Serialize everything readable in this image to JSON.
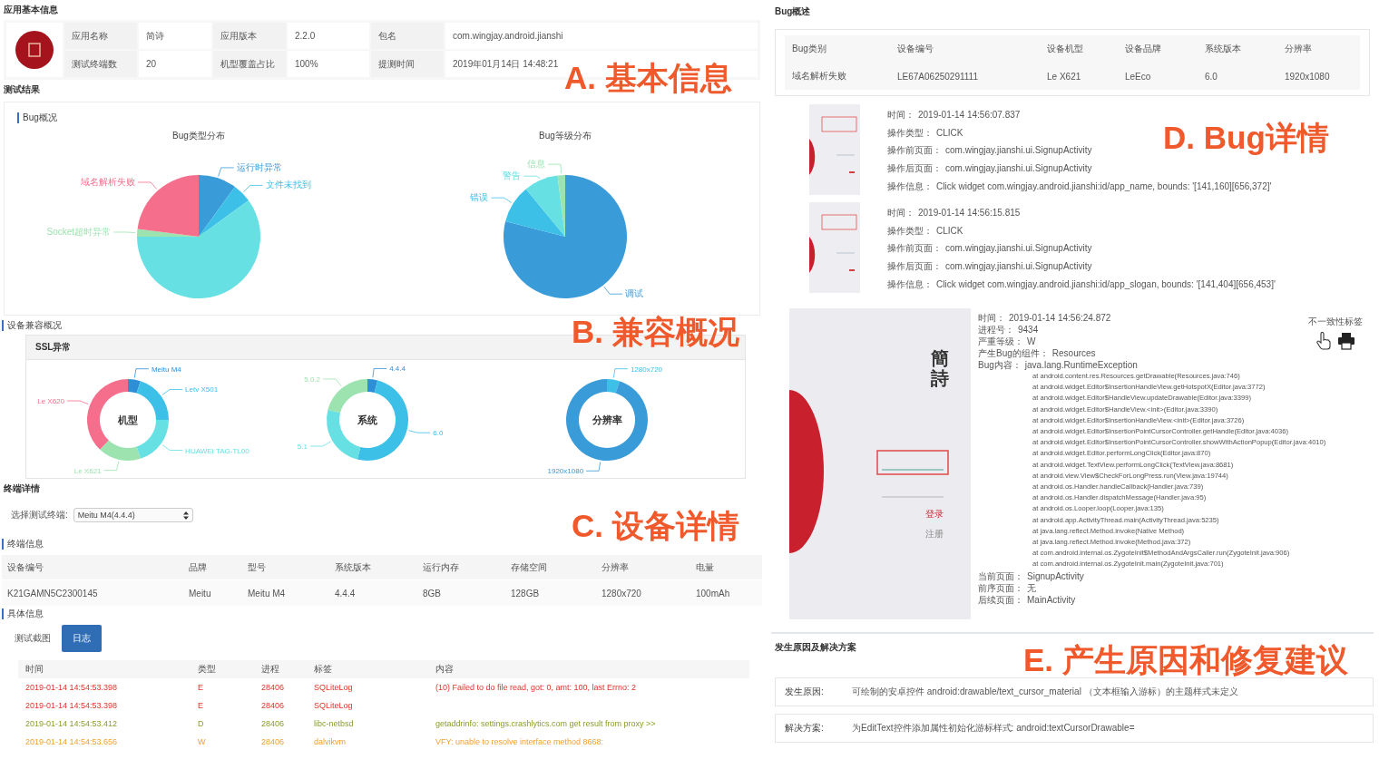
{
  "annotations": [
    {
      "text": "A. 基本信息"
    },
    {
      "text": "B. 兼容概况"
    },
    {
      "text": "C. 设备详情"
    },
    {
      "text": "D. Bug详情"
    },
    {
      "text": "E. 产生原因和修复建议"
    }
  ],
  "app_info": {
    "title": "应用基本信息",
    "fields": [
      {
        "label": "应用名称",
        "value": "简诗"
      },
      {
        "label": "应用版本",
        "value": "2.2.0"
      },
      {
        "label": "包名",
        "value": "com.wingjay.android.jianshi"
      },
      {
        "label": "测试终端数",
        "value": "20"
      },
      {
        "label": "机型覆盖占比",
        "value": "100%"
      },
      {
        "label": "提测时间",
        "value": "2019年01月14日 14:48:21"
      }
    ]
  },
  "test_results": {
    "title": "测试结果",
    "section_title": "Bug概况",
    "charts": [
      {
        "title": "Bug类型分布",
        "slices": [
          {
            "label": "运行时异常",
            "color": "#3a9bd9"
          },
          {
            "label": "文件未找到",
            "color": "#3cc0e8"
          },
          {
            "color": "#66e0e3"
          },
          {
            "label": "Socket超时异常",
            "color": "#9de3b0"
          },
          {
            "label": "域名解析失败",
            "color": "#f56f8d"
          }
        ]
      },
      {
        "title": "Bug等级分布",
        "slices": [
          {
            "label": "调试",
            "color": "#3a9bd9"
          },
          {
            "label": "错误",
            "color": "#3cc0e8"
          },
          {
            "label": "警告",
            "color": "#66e0e3"
          },
          {
            "label": "信息",
            "color": "#9de3b0"
          }
        ]
      }
    ]
  },
  "compatibility": {
    "title": "设备兼容概况",
    "card_title": "SSL异常",
    "charts": [
      {
        "center": "机型",
        "slices": [
          {
            "label": "Meitu M4",
            "color": "#2f8fd6"
          },
          {
            "label": "Letv X501",
            "color": "#3cc0e8"
          },
          {
            "label": "HUAWEI TAG-TL00",
            "color": "#66e0e3"
          },
          {
            "label": "Le X621",
            "color": "#9de3b0"
          },
          {
            "label": "Le X620",
            "color": "#f56f8d"
          }
        ]
      },
      {
        "center": "系统",
        "slices": [
          {
            "label": "4.4.4",
            "color": "#2f8fd6"
          },
          {
            "label": "6.0",
            "color": "#3cc0e8"
          },
          {
            "label": "5.1",
            "color": "#66e0e3"
          },
          {
            "label": "5.0.2",
            "color": "#9de3b0"
          }
        ]
      },
      {
        "center": "分辨率",
        "slices": [
          {
            "label": "1280x720",
            "color": "#3cc0e8"
          },
          {
            "label": "1920x1080",
            "color": "#3a9bd9"
          }
        ]
      }
    ]
  },
  "terminal": {
    "title": "终端详情",
    "select_label": "选择测试终端:",
    "select_value": "Meitu M4(4.4.4)",
    "info_title": "终端信息",
    "columns": [
      "设备编号",
      "品牌",
      "型号",
      "系统版本",
      "运行内存",
      "存储空间",
      "分辨率",
      "电量"
    ],
    "row": [
      "K21GAMN5C2300145",
      "Meitu",
      "Meitu M4",
      "4.4.4",
      "8GB",
      "128GB",
      "1280x720",
      "100mAh"
    ]
  },
  "details": {
    "title": "具体信息",
    "tabs": [
      {
        "label": "测试截图",
        "selected": false
      },
      {
        "label": "日志",
        "selected": true
      }
    ],
    "log": {
      "columns": [
        "时间",
        "类型",
        "进程",
        "标签",
        "内容"
      ],
      "rows": [
        {
          "kind": "error",
          "cells": [
            "2019-01-14 14:54:53.398",
            "E",
            "28406",
            "SQLiteLog",
            "(10) Failed to do file read, got: 0, amt: 100, last Errno: 2"
          ]
        },
        {
          "kind": "error",
          "cells": [
            "2019-01-14 14:54:53.398",
            "E",
            "28406",
            "SQLiteLog"
          ]
        },
        {
          "kind": "debug",
          "cells": [
            "2019-01-14 14:54:53.412",
            "D",
            "28406",
            "libc-netbsd",
            "getaddrinfo: settings.crashlytics.com get result from proxy >>"
          ]
        },
        {
          "kind": "warning",
          "cells": [
            "2019-01-14 14:54:53.656",
            "W",
            "28406",
            "dalvikvm",
            "VFY: unable to resolve interface method 8668:"
          ]
        }
      ]
    }
  },
  "bug_summary": {
    "title": "Bug概述",
    "columns": [
      "Bug类别",
      "设备编号",
      "设备机型",
      "设备品牌",
      "系统版本",
      "分辨率"
    ],
    "row": [
      "域名解析失败",
      "LE67A06250291111",
      "Le X621",
      "LeEco",
      "6.0",
      "1920x1080"
    ]
  },
  "bug_steps": [
    {
      "lines": [
        {
          "label": "时间：",
          "value": "2019-01-14 14:56:07.837"
        },
        {
          "label": "操作类型：",
          "value": "CLICK"
        },
        {
          "label": "操作前页面：",
          "value": "com.wingjay.jianshi.ui.SignupActivity"
        },
        {
          "label": "操作后页面：",
          "value": "com.wingjay.jianshi.ui.SignupActivity"
        },
        {
          "label": "操作信息：",
          "value": "Click widget com.wingjay.android.jianshi:id/app_name, bounds: '[141,160][656,372]'"
        }
      ]
    },
    {
      "lines": [
        {
          "label": "时间：",
          "value": "2019-01-14 14:56:15.815"
        },
        {
          "label": "操作类型：",
          "value": "CLICK"
        },
        {
          "label": "操作前页面：",
          "value": "com.wingjay.jianshi.ui.SignupActivity"
        },
        {
          "label": "操作后页面：",
          "value": "com.wingjay.jianshi.ui.SignupActivity"
        },
        {
          "label": "操作信息：",
          "value": "Click widget com.wingjay.android.jianshi:id/app_slogan, bounds: '[141,404][656,453]'"
        }
      ]
    }
  ],
  "bug_detail": {
    "app_title": "簡詩",
    "buttons": [
      "登录",
      "注册"
    ],
    "tag_title": "不一致性标签",
    "fields": [
      {
        "label": "时间：",
        "value": "2019-01-14 14:56:24.872"
      },
      {
        "label": "进程号：",
        "value": "9434"
      },
      {
        "label": "严重等级：",
        "value": "W"
      },
      {
        "label": "产生Bug的组件：",
        "value": "Resources"
      },
      {
        "label": "Bug内容：",
        "value": "java.lang.RuntimeException"
      }
    ],
    "stack": [
      "at android.content.res.Resources.getDrawable(Resources.java:746)",
      "at android.widget.Editor$InsertionHandleView.getHotspotX(Editor.java:3772)",
      "at android.widget.Editor$HandleView.updateDrawable(Editor.java:3399)",
      "at android.widget.Editor$HandleView.<init>(Editor.java:3390)",
      "at android.widget.Editor$InsertionHandleView.<init>(Editor.java:3726)",
      "at android.widget.Editor$InsertionPointCursorController.getHandle(Editor.java:4036)",
      "at android.widget.Editor$InsertionPointCursorController.showWithActionPopup(Editor.java:4010)",
      "at android.widget.Editor.performLongClick(Editor.java:870)",
      "at android.widget.TextView.performLongClick(TextView.java:8681)",
      "at android.view.View$CheckForLongPress.run(View.java:19744)",
      "at android.os.Handler.handleCallback(Handler.java:739)",
      "at android.os.Handler.dispatchMessage(Handler.java:95)",
      "at android.os.Looper.loop(Looper.java:135)",
      "at android.app.ActivityThread.main(ActivityThread.java:5235)",
      "at java.lang.reflect.Method.invoke(Native Method)",
      "at java.lang.reflect.Method.invoke(Method.java:372)",
      "at com.android.internal.os.ZygoteInit$MethodAndArgsCaller.run(ZygoteInit.java:906)",
      "at com.android.internal.os.ZygoteInit.main(ZygoteInit.java:701)"
    ],
    "pages": [
      {
        "label": "当前页面：",
        "value": "SignupActivity"
      },
      {
        "label": "前序页面：",
        "value": "无"
      },
      {
        "label": "后续页面：",
        "value": "MainActivity"
      }
    ]
  },
  "solution": {
    "title": "发生原因及解决方案",
    "rows": [
      {
        "label": "发生原因:",
        "value": "可绘制的安卓控件 android:drawable/text_cursor_material （文本框输入游标）的主题样式未定义"
      },
      {
        "label": "解决方案:",
        "value": "为EditText控件添加属性初始化游标样式: android:textCursorDrawable="
      }
    ]
  }
}
